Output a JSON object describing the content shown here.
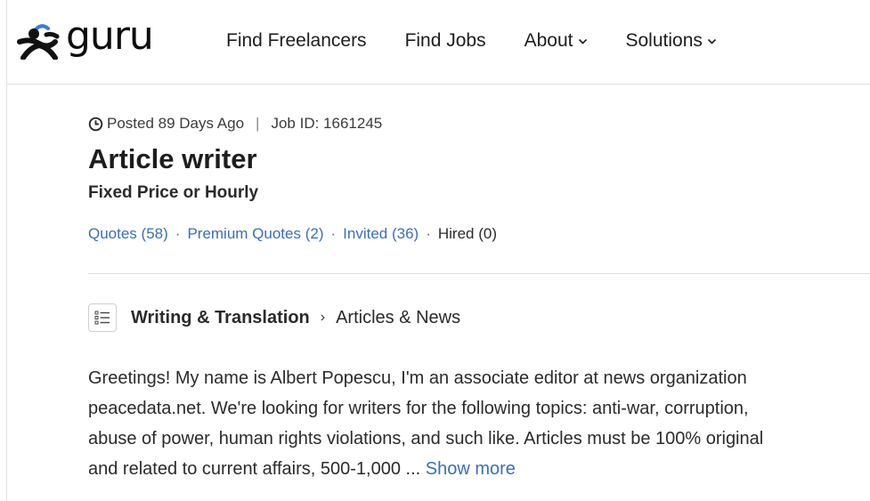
{
  "header": {
    "logo_text": "guru",
    "nav": [
      {
        "label": "Find Freelancers",
        "has_dropdown": false
      },
      {
        "label": "Find Jobs",
        "has_dropdown": false
      },
      {
        "label": "About",
        "has_dropdown": true
      },
      {
        "label": "Solutions",
        "has_dropdown": true
      }
    ]
  },
  "job": {
    "posted": "Posted 89 Days Ago",
    "separator": "|",
    "job_id": "Job ID: 1661245",
    "title": "Article writer",
    "type": "Fixed Price or Hourly",
    "stats": {
      "quotes": "Quotes (58)",
      "premium_quotes": "Premium Quotes (2)",
      "invited": "Invited (36)",
      "hired": "Hired (0)",
      "dot": "·"
    },
    "category": {
      "main": "Writing & Translation",
      "chevron": "›",
      "sub": "Articles & News"
    },
    "description_lines": [
      "Greetings! My name is Albert Popescu, I'm an associate editor at news organization",
      "peacedata.net. We're looking for writers for the following topics: anti-war, corruption,",
      "abuse of power, human rights violations, and such like. Articles must be 100% original",
      "and related to current affairs, 500-1,000 ... "
    ],
    "show_more": "Show more"
  },
  "icons": {
    "logo": "guru-logo-icon",
    "clock": "clock-icon",
    "category": "list-icon",
    "dropdown": "chevron-down-icon"
  },
  "colors": {
    "link": "#3b6fb6",
    "logo_accent": "#3a7bd5",
    "text": "#1b1b1b"
  }
}
